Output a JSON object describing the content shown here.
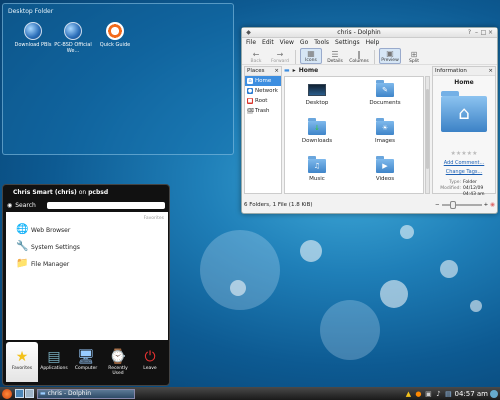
{
  "desktop_folder": {
    "title": "Desktop Folder",
    "icons": [
      {
        "label": "Download PBIs",
        "icon": "globe-icon"
      },
      {
        "label": "PC-BSD Official We...",
        "icon": "globe-icon"
      },
      {
        "label": "Quick Guide",
        "icon": "lifebuoy-icon"
      }
    ]
  },
  "dolphin": {
    "title": "chris - Dolphin",
    "menu": [
      "File",
      "Edit",
      "View",
      "Go",
      "Tools",
      "Settings",
      "Help"
    ],
    "toolbar": [
      {
        "label": "Back",
        "icon": "←"
      },
      {
        "label": "Forward",
        "icon": "→"
      },
      {
        "label": "Icons",
        "icon": "▦"
      },
      {
        "label": "Details",
        "icon": "☰"
      },
      {
        "label": "Columns",
        "icon": "‖"
      },
      {
        "label": "Preview",
        "icon": "▣"
      },
      {
        "label": "Split",
        "icon": "⊞"
      }
    ],
    "places_title": "Places",
    "places": [
      {
        "label": "Home",
        "color": "#3d8ee0"
      },
      {
        "label": "Network",
        "color": "#2a7bd1"
      },
      {
        "label": "Root",
        "color": "#d9342b"
      },
      {
        "label": "Trash",
        "color": "#888888"
      }
    ],
    "breadcrumb": "Home",
    "files": [
      {
        "label": "Desktop"
      },
      {
        "label": "Documents"
      },
      {
        "label": "Downloads"
      },
      {
        "label": "Images"
      },
      {
        "label": "Music"
      },
      {
        "label": "Videos"
      }
    ],
    "info": {
      "title": "Information",
      "name": "Home",
      "add_comment": "Add Comment...",
      "change_tags": "Change Tags...",
      "type_key": "Type:",
      "type_value": "Folder",
      "modified_key": "Modified:",
      "modified_value": "04/12/09 04:43 am"
    },
    "status": "6 Folders, 1 File (1.8 KiB)"
  },
  "kickoff": {
    "user": "Chris Smart (chris)",
    "host_prefix": "on",
    "host": "pcbsd",
    "search_label": "Search",
    "favorites_heading": "Favorites",
    "items": [
      {
        "label": "Web Browser",
        "icon": "🌐"
      },
      {
        "label": "System Settings",
        "icon": "🔧"
      },
      {
        "label": "File Manager",
        "icon": "📁"
      }
    ],
    "tabs": [
      {
        "label": "Favorites",
        "icon": "★"
      },
      {
        "label": "Applications",
        "icon": "▤"
      },
      {
        "label": "Computer",
        "icon": "🖥"
      },
      {
        "label": "Recently Used",
        "icon": "⌚"
      },
      {
        "label": "Leave",
        "icon": "⏻"
      }
    ]
  },
  "panel": {
    "task_label": "chris - Dolphin",
    "clock": "04:57 am"
  }
}
